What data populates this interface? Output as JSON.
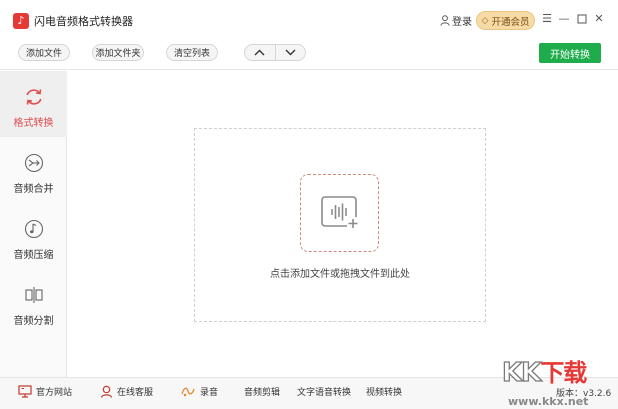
{
  "titlebar": {
    "app_icon": "music-note-icon",
    "title": "闪电音频格式转换器",
    "login_label": "登录",
    "vip_label": "开通会员",
    "controls": [
      "menu-icon",
      "minimize-icon",
      "maximize-icon",
      "close-icon"
    ]
  },
  "toolbar": {
    "add_file": "添加文件",
    "add_folder": "添加文件夹",
    "clear_list": "清空列表",
    "move_up_icon": "chevron-up-icon",
    "move_down_icon": "chevron-down-icon",
    "start_convert": "开始转换"
  },
  "sidebar": {
    "items": [
      {
        "label": "格式转换",
        "icon": "convert-icon",
        "active": true
      },
      {
        "label": "音频合并",
        "icon": "merge-icon",
        "active": false
      },
      {
        "label": "音频压缩",
        "icon": "compress-icon",
        "active": false
      },
      {
        "label": "音频分割",
        "icon": "split-icon",
        "active": false
      }
    ]
  },
  "main": {
    "drop_icon": "add-audio-icon",
    "drop_hint": "点击添加文件或拖拽文件到此处"
  },
  "bottombar": {
    "website": "官方网站",
    "support": "在线客服",
    "record": "录音",
    "audio_cut": "音频剪辑",
    "tts": "文字语音转换",
    "video_convert": "视频转换",
    "version": "版本：v3.2.6"
  },
  "watermark": {
    "logo": "KK下载",
    "url": "www.kkx.net"
  },
  "colors": {
    "accent_red": "#e14c4c",
    "start_green": "#1fac4b",
    "vip_gold": "#f6dba6",
    "drop_border": "#c98a78"
  }
}
